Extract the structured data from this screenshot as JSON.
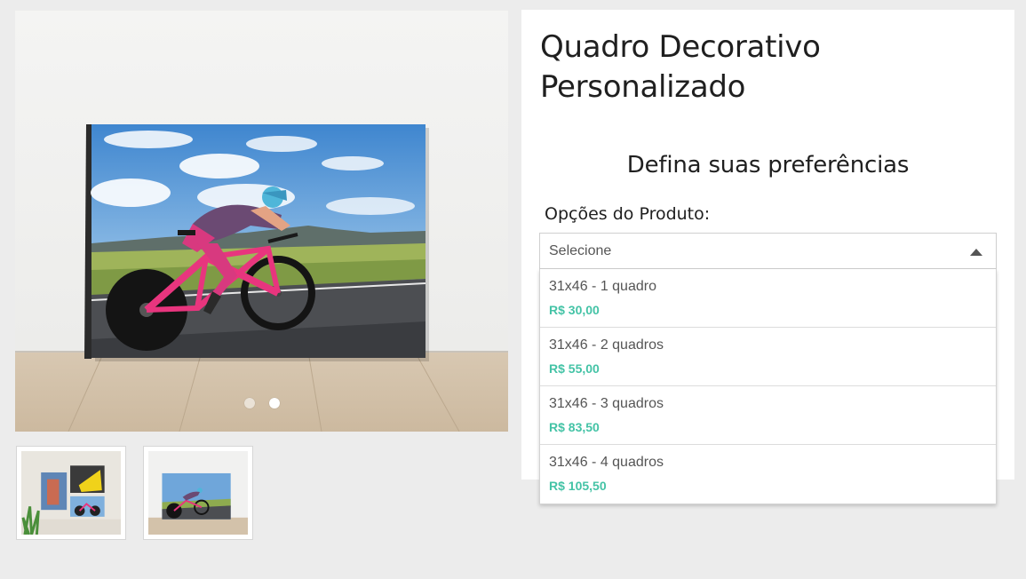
{
  "product": {
    "title": "Quadro Decorativo Personalizado"
  },
  "gallery": {
    "main_image": "canvas-cyclist-photo",
    "slides": [
      {
        "active": false
      },
      {
        "active": true
      }
    ],
    "thumbnails": [
      {
        "image": "wall-collage-thumbnail"
      },
      {
        "image": "canvas-cyclist-thumbnail"
      }
    ]
  },
  "preferences": {
    "heading": "Defina suas preferências",
    "options_label": "Opções do Produto:",
    "select_placeholder": "Selecione",
    "options": [
      {
        "name": "31x46 - 1 quadro",
        "price": "R$ 30,00"
      },
      {
        "name": "31x46 - 2 quadros",
        "price": "R$ 55,00"
      },
      {
        "name": "31x46 - 3 quadros",
        "price": "R$ 83,50"
      },
      {
        "name": "31x46 - 4 quadros",
        "price": "R$ 105,50"
      }
    ]
  },
  "colors": {
    "price_accent": "#44c3a6",
    "page_background": "#ececec"
  }
}
